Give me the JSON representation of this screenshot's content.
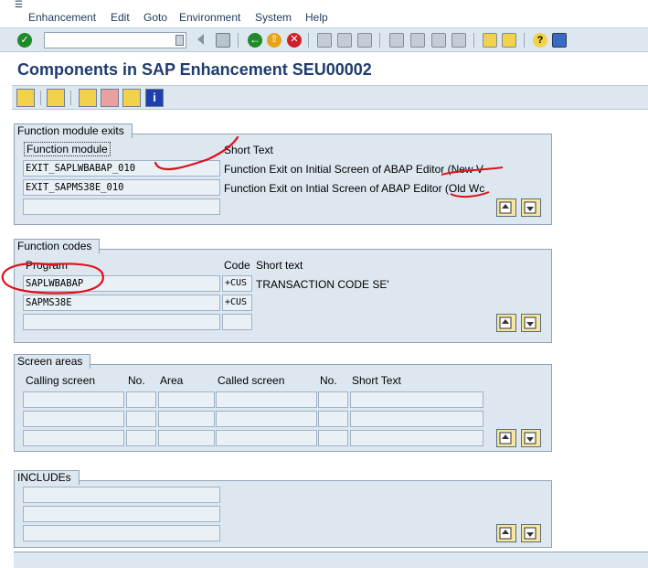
{
  "menu": {
    "items": [
      "Enhancement",
      "Edit",
      "Goto",
      "Environment",
      "System",
      "Help"
    ]
  },
  "toolbar": {
    "command_value": "",
    "icons": [
      "enter-icon",
      "back-icon",
      "exit-icon",
      "cancel-icon",
      "print-icon",
      "find-icon",
      "find-next-icon",
      "first-page-icon",
      "previous-page-icon",
      "next-page-icon",
      "last-page-icon",
      "new-session-icon",
      "shortcut-icon",
      "help-icon",
      "layout-icon"
    ]
  },
  "title": "Components in SAP Enhancement SEU00002",
  "app_toolbar": {
    "icons": [
      "display-change-icon",
      "other-object-icon",
      "check-icon",
      "activate-icon",
      "list-icon",
      "info-icon"
    ]
  },
  "function_module_exits": {
    "title": "Function module exits",
    "col_function_module": "Function module",
    "col_short_text": "Short Text",
    "rows": [
      {
        "name": "EXIT_SAPLWBABAP_010",
        "text": "Function Exit on Initial Screen of ABAP Editor (New V"
      },
      {
        "name": "EXIT_SAPMS38E_010",
        "text": "Function Exit on Intial Screen of ABAP Editor (Old Wc"
      },
      {
        "name": "",
        "text": ""
      }
    ]
  },
  "function_codes": {
    "title": "Function codes",
    "col_program": "Program",
    "col_code": "Code",
    "col_short_text": "Short text",
    "rows": [
      {
        "program": "SAPLWBABAP",
        "code": "+CUS",
        "text": "TRANSACTION CODE SE'"
      },
      {
        "program": "SAPMS38E",
        "code": "+CUS",
        "text": ""
      },
      {
        "program": "",
        "code": "",
        "text": ""
      }
    ]
  },
  "screen_areas": {
    "title": "Screen areas",
    "col_calling_screen": "Calling screen",
    "col_no1": "No.",
    "col_area": "Area",
    "col_called_screen": "Called screen",
    "col_no2": "No.",
    "col_short_text": "Short Text"
  },
  "includes": {
    "title": "INCLUDEs"
  },
  "annotation_color": "#e0101a",
  "accent_color": "#1f3c6e"
}
